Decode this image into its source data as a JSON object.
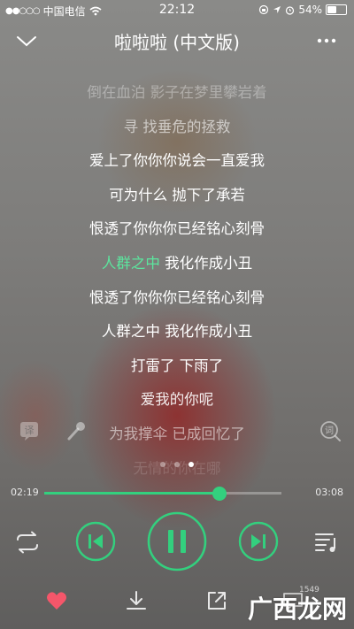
{
  "status_bar": {
    "carrier": "中国电信",
    "time": "22:12",
    "battery": "54%",
    "battery_level": 0.54
  },
  "header": {
    "title": "啦啦啦 (中文版)"
  },
  "lyrics": [
    {
      "text": "倒在血泊 影子在梦里攀岩着",
      "opacity": 0.35
    },
    {
      "text": "寻 找垂危的拯救",
      "opacity": 0.6
    },
    {
      "text": "爱上了你你你说会一直爱我",
      "opacity": 1
    },
    {
      "text": "可为什么 抛下了承若",
      "opacity": 1
    },
    {
      "text": "恨透了你你你已经铭心刻骨",
      "opacity": 1
    },
    {
      "text": "我化作成小丑",
      "highlight": "人群之中 ",
      "opacity": 1
    },
    {
      "text": "恨透了你你你已经铭心刻骨",
      "opacity": 1
    },
    {
      "text": "人群之中 我化作成小丑",
      "opacity": 1
    },
    {
      "text": "打雷了 下雨了",
      "opacity": 1
    },
    {
      "text": "爱我的你呢",
      "opacity": 0.9
    },
    {
      "text": "为我撑伞 已成回忆了",
      "opacity": 0.55
    },
    {
      "text": "无情的你在哪",
      "opacity": 0.15
    }
  ],
  "progress": {
    "elapsed": "02:19",
    "total": "03:08",
    "fraction": 0.74
  },
  "pager": {
    "count": 3,
    "active": 2
  },
  "bottom": {
    "comment_count": "1549"
  },
  "watermark": {
    "text": "广西龙网"
  },
  "colors": {
    "accent": "#33d07e",
    "lyric_highlight": "#5ce59e",
    "heart": "#f5566a"
  },
  "icons": [
    "chevron-down-icon",
    "more-icon",
    "translate-icon",
    "microphone-icon",
    "word-search-icon",
    "repeat-icon",
    "previous-icon",
    "pause-icon",
    "next-icon",
    "playlist-icon",
    "heart-icon",
    "download-icon",
    "share-icon",
    "comment-icon"
  ]
}
